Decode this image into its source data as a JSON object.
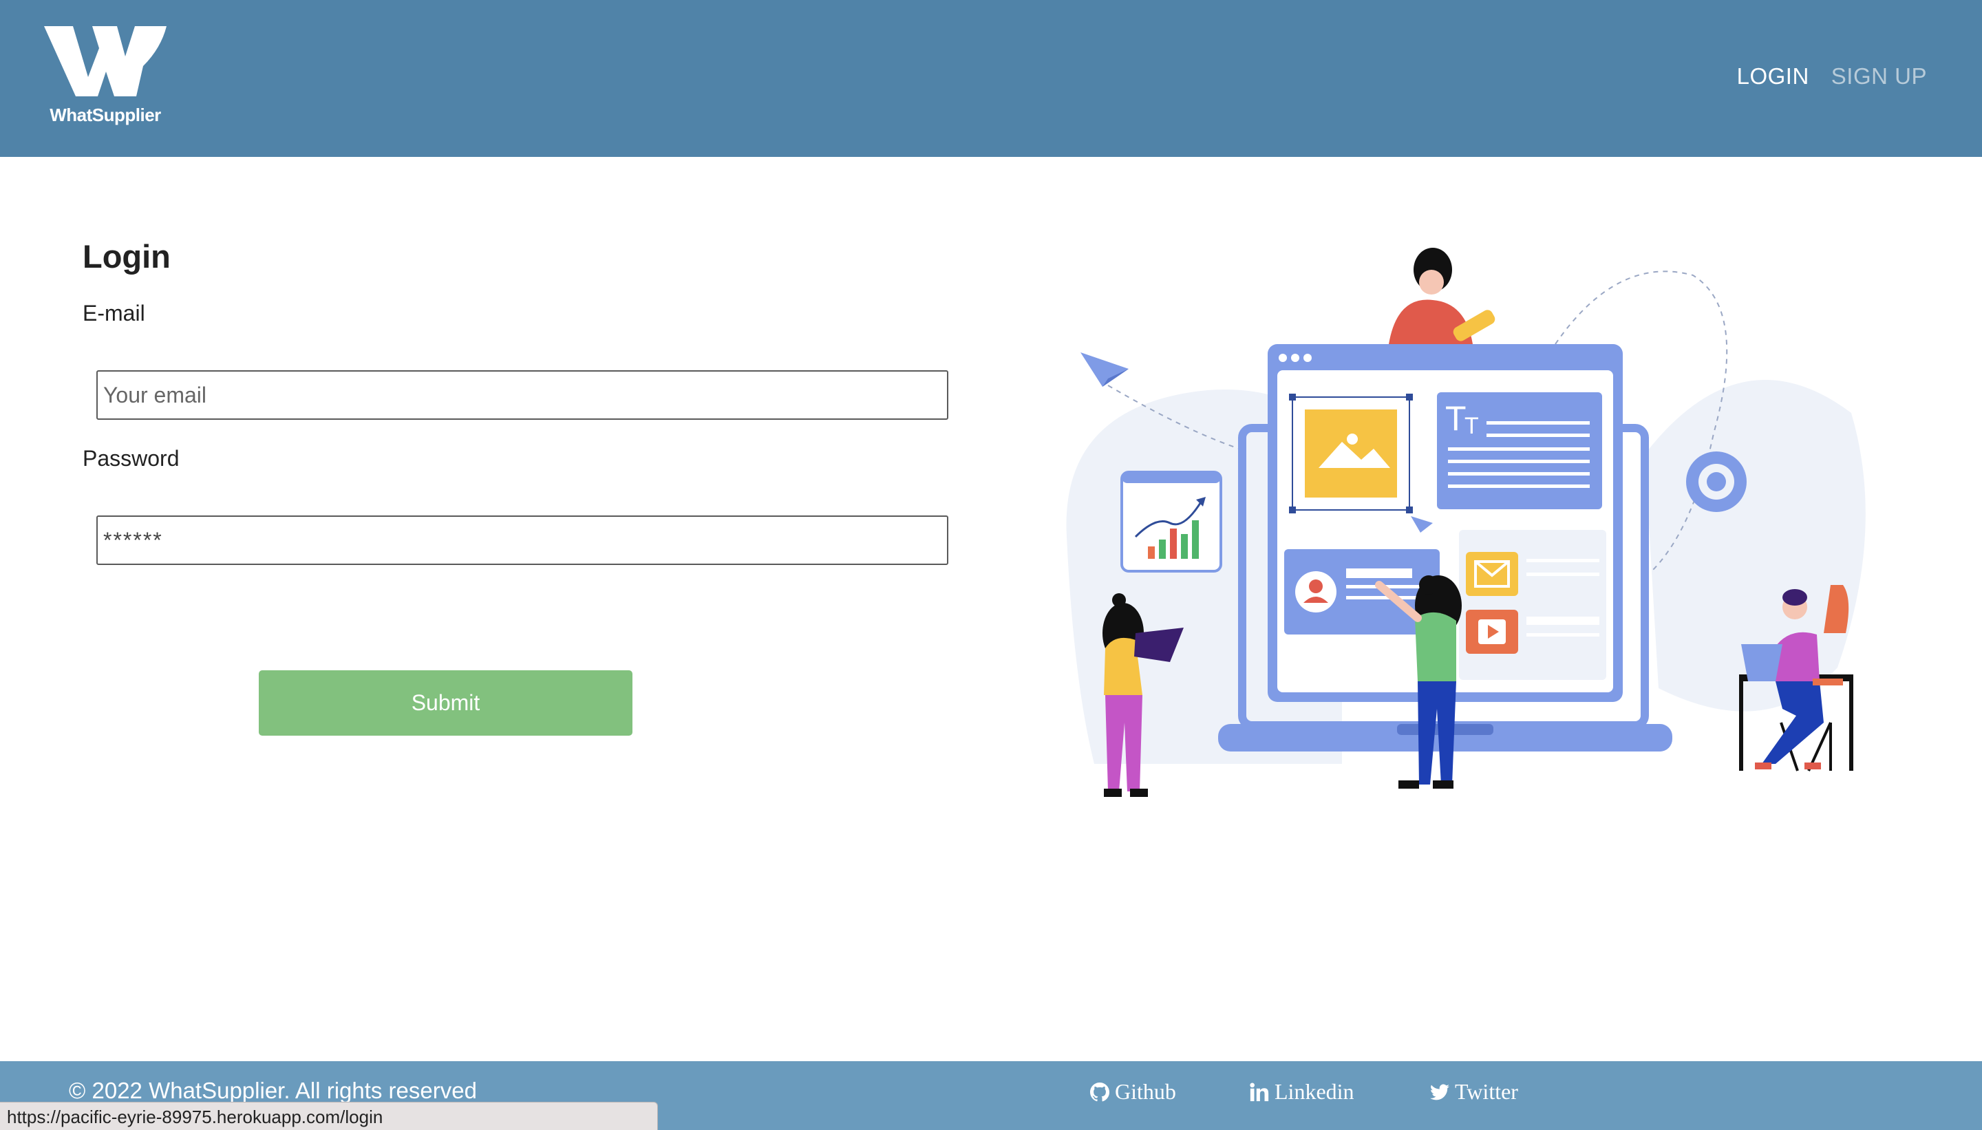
{
  "header": {
    "logo_text": "WhatSupplier",
    "nav": {
      "login": "LOGIN",
      "signup": "SIGN UP"
    }
  },
  "form": {
    "title": "Login",
    "email_label": "E-mail",
    "email_placeholder": "Your email",
    "password_label": "Password",
    "password_placeholder": "******",
    "submit_label": "Submit"
  },
  "footer": {
    "copyright": "© 2022 WhatSupplier. All rights reserved",
    "links": {
      "github": "Github",
      "linkedin": "Linkedin",
      "twitter": "Twitter"
    }
  },
  "statusbar": {
    "url": "https://pacific-eyrie-89975.herokuapp.com/login"
  },
  "colors": {
    "header_bg": "#5083a8",
    "footer_bg": "#6a9bbd",
    "submit_bg": "#82c17e",
    "illustration_primary": "#7f9be6"
  },
  "icons": {
    "logo": "whatsupplier-w-logo",
    "github": "github-icon",
    "linkedin": "linkedin-icon",
    "twitter": "twitter-icon"
  }
}
